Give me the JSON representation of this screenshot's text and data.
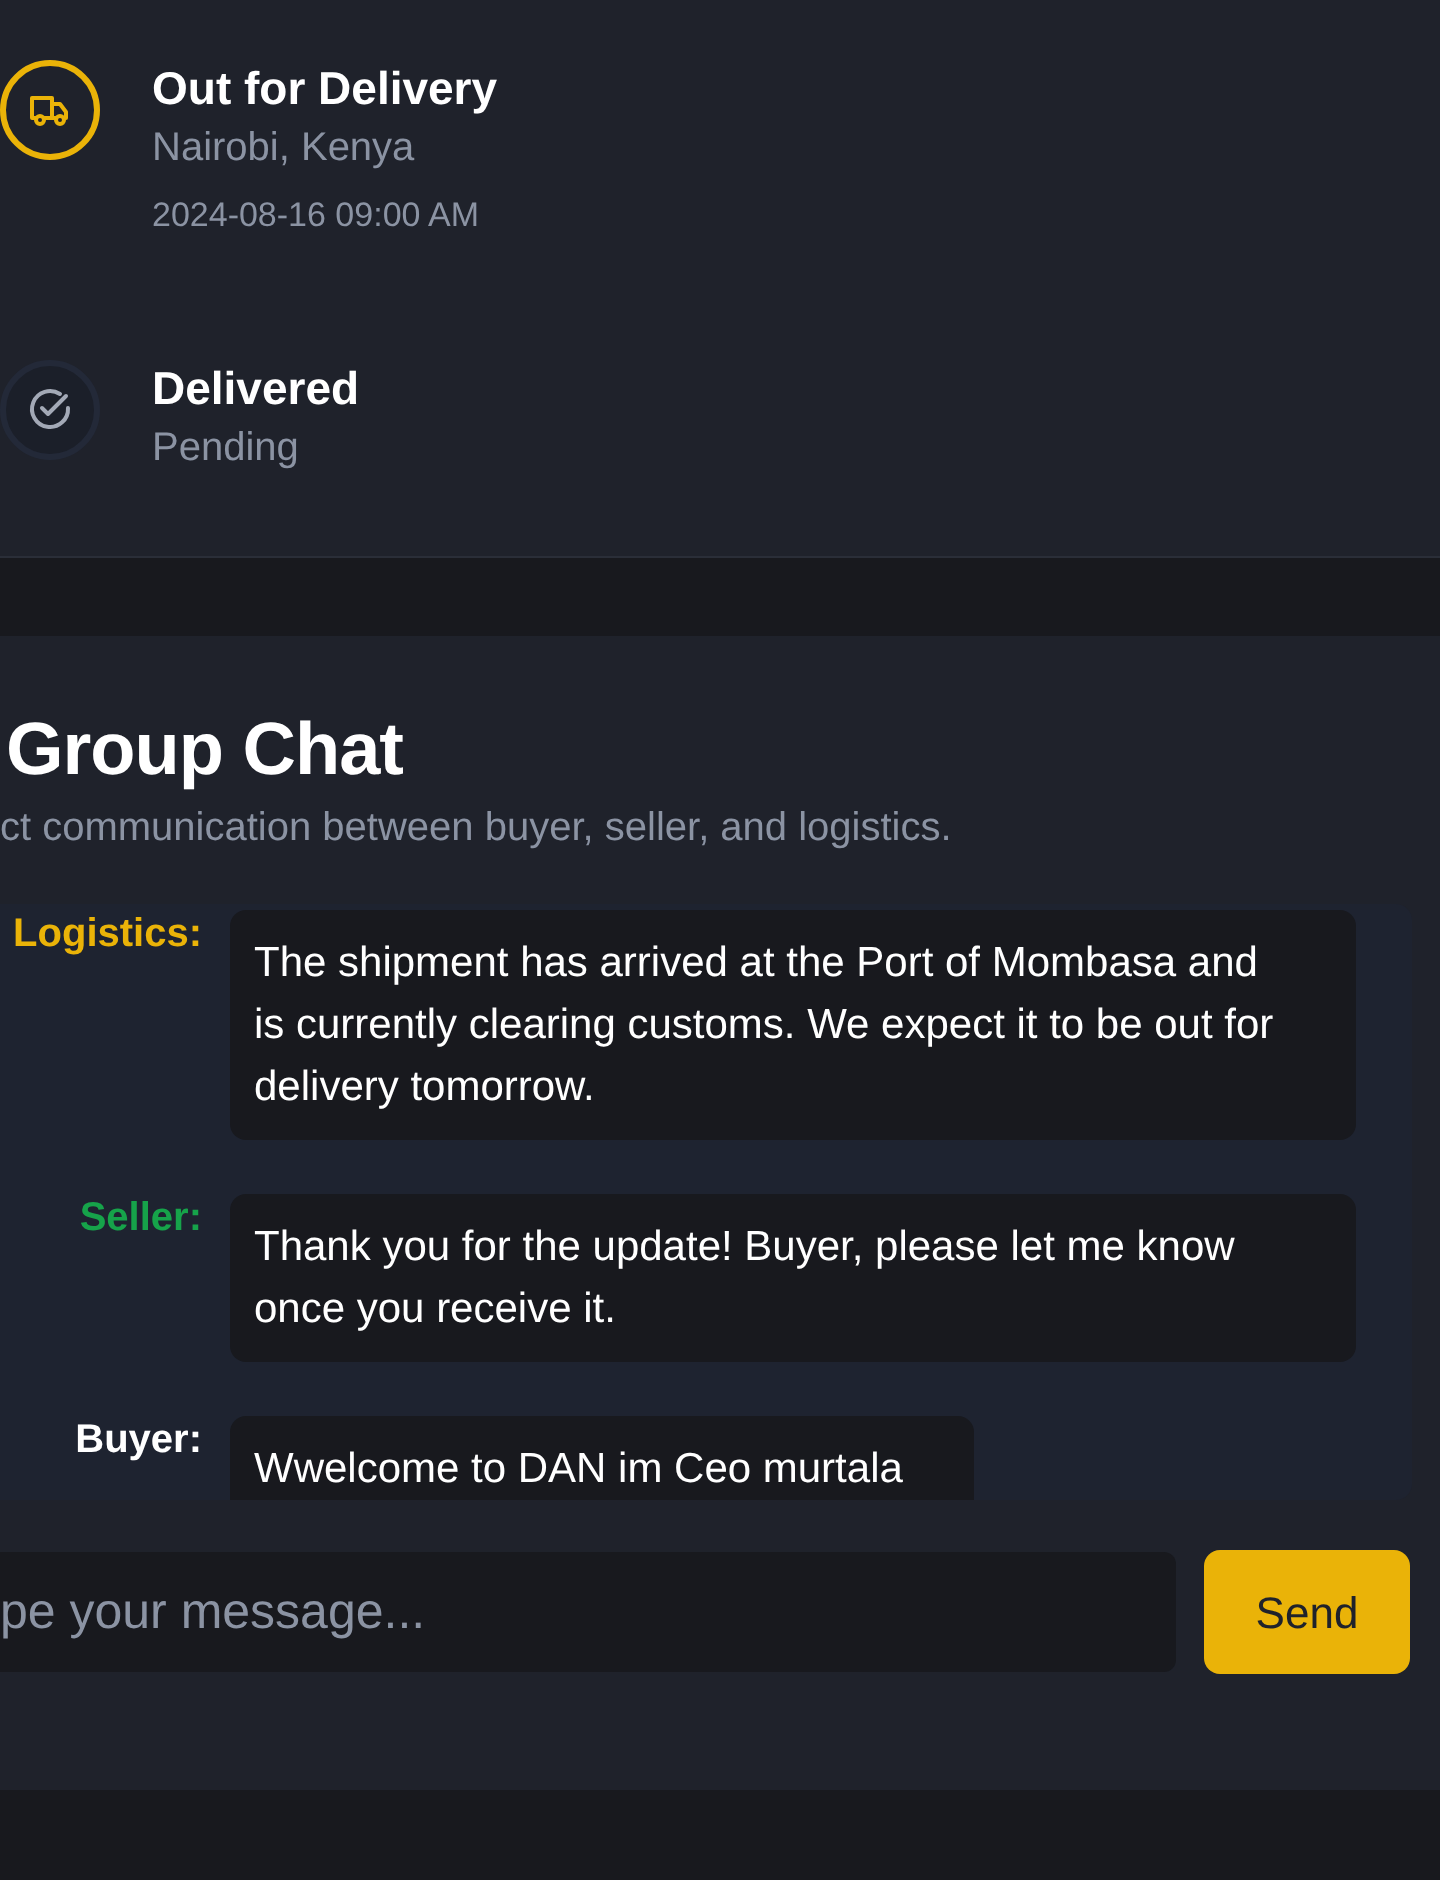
{
  "timeline": [
    {
      "reached": true,
      "title": "Out for Delivery",
      "location": "Nairobi, Kenya",
      "time": "2024-08-16 09:00 AM"
    },
    {
      "reached": false,
      "title": "Delivered",
      "location": "Pending"
    }
  ],
  "chat": {
    "title": "Group Chat",
    "subtitle": "ct communication between buyer, seller, and logistics.",
    "messages": [
      {
        "sender": "Logistics:",
        "color": "#eab308",
        "text": "The shipment has arrived at the Port of Mombasa and is currently clearing customs. We expect it to be out for delivery tomorrow."
      },
      {
        "sender": "Seller:",
        "color": "#16a34a",
        "text": "Thank you for the update! Buyer, please let me know once you receive it."
      },
      {
        "sender": "Buyer:",
        "color": "#ffffff",
        "text": "Wwelcome to DAN im Ceo murtala"
      }
    ],
    "input": {
      "placeholder": "pe your message..."
    },
    "send_button": "Send"
  }
}
